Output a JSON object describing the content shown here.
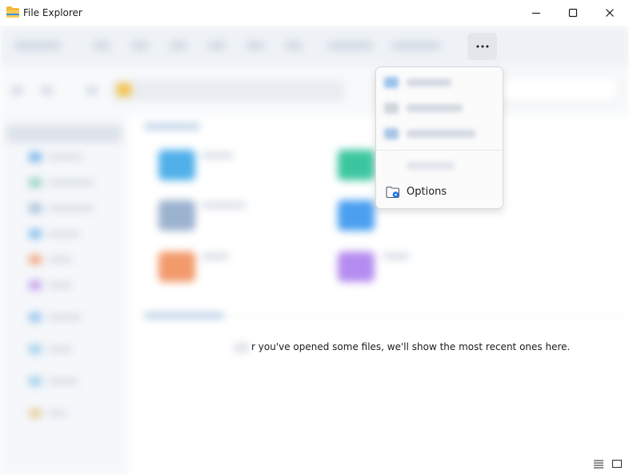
{
  "window": {
    "title": "File Explorer"
  },
  "toolbar": {
    "more_label": "..."
  },
  "menu": {
    "items": [
      {
        "label": "Options",
        "icon": "folder-options-icon"
      }
    ]
  },
  "content": {
    "recent_empty_message": "r you've opened some files, we'll show the most recent ones here."
  },
  "colors": {
    "folder_yellow": "#f4b73a",
    "accent_blue": "#1a73e8",
    "more_button_bg": "#e3e7ec"
  }
}
